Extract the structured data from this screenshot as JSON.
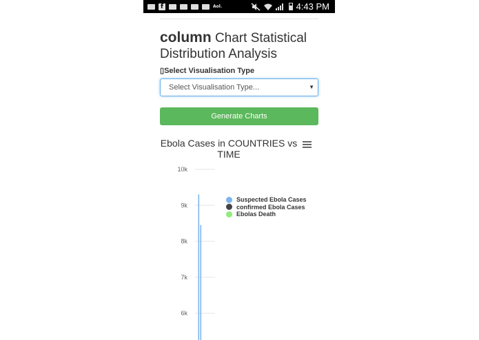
{
  "status_bar": {
    "time": "4:43 PM",
    "icons": [
      "message-icon",
      "facebook-icon",
      "mail-icon",
      "mail-icon",
      "mail-icon",
      "mail-icon",
      "aol-icon",
      "mute-icon",
      "wifi-icon",
      "signal-icon",
      "battery-icon"
    ],
    "aol_label": "Aol."
  },
  "page": {
    "title_bold": "column",
    "title_rest": " Chart Statistical Distribution Analysis"
  },
  "form": {
    "select_label": "Select Visualisation Type",
    "select_value": "Select Visualisation Type...",
    "generate_label": "Generate Charts"
  },
  "colors": {
    "accent_button": "#5cb85c",
    "series_suspected": "#7cb5ec",
    "series_confirmed": "#434348",
    "series_deaths": "#90ed7d"
  },
  "chart_data": {
    "type": "bar",
    "title": "Ebola Cases in COUNTRIES vs TIME",
    "y_ticks": [
      "10k",
      "9k",
      "8k",
      "7k",
      "6k"
    ],
    "ylim": [
      5200,
      10000
    ],
    "legend_placement": "top-right",
    "series": [
      {
        "name": "Suspected Ebola Cases",
        "values": [
          9300,
          8450
        ]
      },
      {
        "name": "confirmed Ebola Cases",
        "values": []
      },
      {
        "name": "Ebolas Death",
        "values": []
      }
    ]
  },
  "icons": {
    "chart_menu": "hamburger-menu-icon"
  }
}
